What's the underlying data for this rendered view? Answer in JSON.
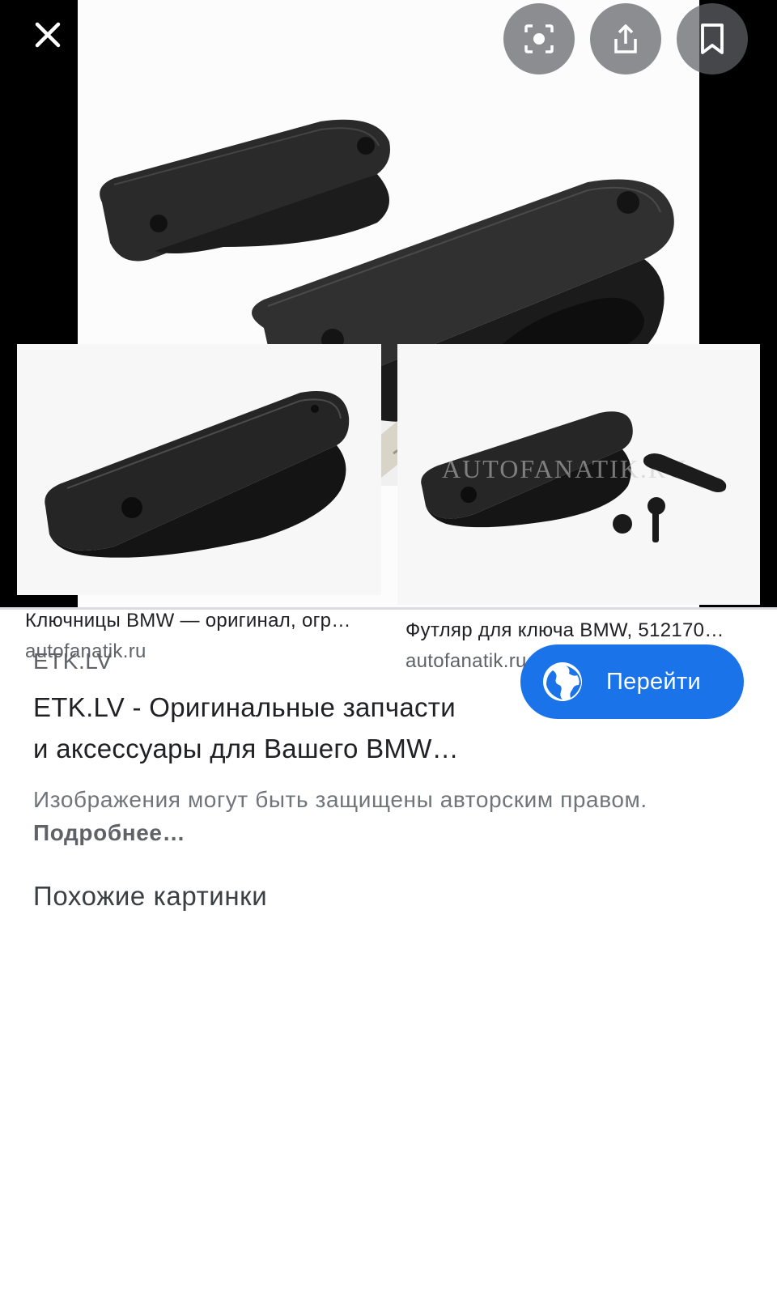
{
  "viewer": {
    "close_icon": "close-icon",
    "lens_icon": "lens-icon",
    "share_icon": "share-icon",
    "bookmark_icon": "bookmark-icon"
  },
  "result": {
    "source": "ETK.LV",
    "title_line1": "ETK.LV - Оригинальные запчасти",
    "title_line2": "и аксессуары для Вашего BMW…",
    "visit_button": "Перейти",
    "visit_icon": "globe-icon",
    "copyright": "Изображения могут быть защищены авторским правом.",
    "more_link": "Подробнее…"
  },
  "related": {
    "heading": "Похожие картинки",
    "items": [
      {
        "title": "Ключницы BMW — оригинал, огр…",
        "source": "autofanatik.ru"
      },
      {
        "title": "Футляр для ключа BMW, 512170…",
        "source": "autofanatik.ru",
        "watermark": "AUTOFANATIK.RU"
      }
    ]
  },
  "colors": {
    "accent": "#1a73e8",
    "viewer_bg": "#000000"
  }
}
